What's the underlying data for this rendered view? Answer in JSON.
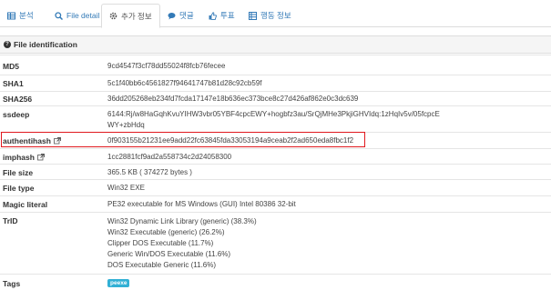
{
  "tabs": [
    {
      "label": "분석",
      "icon": "table-icon"
    },
    {
      "label": "File detail",
      "icon": "search-icon"
    },
    {
      "label": "추가 정보",
      "icon": "gear-icon",
      "active": true
    },
    {
      "label": "댓글",
      "icon": "comment-icon"
    },
    {
      "label": "투표",
      "icon": "thumbs-icon"
    },
    {
      "label": "행동 정보",
      "icon": "grid-icon"
    }
  ],
  "section": {
    "title": "File identification"
  },
  "fields": {
    "md5": {
      "label": "MD5",
      "value": "9cd4547f3cf78dd55024f8fcb76fecee"
    },
    "sha1": {
      "label": "SHA1",
      "value": "5c1f40bb6c4561827f94641747b81d28c92cb59f"
    },
    "sha256": {
      "label": "SHA256",
      "value": "36dd205268eb234fd7fcda17147e18b636ec373bce8c27d426af862e0c3dc639"
    },
    "ssdeep": {
      "label": "ssdeep",
      "value_line1": "6144:Rj/w8HaGqhKvuYIHW3vbr05YBF4cpcEWY+hogbfz3au/SrQjMHe3PkjiGHVIdq:1zHqIv5v/05fcpcE",
      "value_line2": "WY+zbHdq"
    },
    "authentihash": {
      "label": "authentihash",
      "value": "0f903155b21231ee9add22fc63845fda33053194a9ceab2f2ad650eda8fbc1f2"
    },
    "imphash": {
      "label": "imphash",
      "value": "1cc2881fcf9ad2a558734c2d24058300"
    },
    "file_size": {
      "label": "File size",
      "value": "365.5 KB ( 374272 bytes )"
    },
    "file_type": {
      "label": "File type",
      "value": "Win32 EXE"
    },
    "magic": {
      "label": "Magic literal",
      "value": "PE32 executable for MS Windows (GUI) Intel 80386 32-bit"
    },
    "trid": {
      "label": "TrID",
      "values": [
        "Win32 Dynamic Link Library (generic) (38.3%)",
        "Win32 Executable (generic) (26.2%)",
        "Clipper DOS Executable (11.7%)",
        "Generic Win/DOS Executable (11.6%)",
        "DOS Executable Generic (11.6%)"
      ]
    },
    "tags": {
      "label": "Tags",
      "value": "peexe"
    }
  },
  "colors": {
    "accent": "#337ab7",
    "highlight": "#e0191f",
    "badge": "#31b0d5"
  }
}
